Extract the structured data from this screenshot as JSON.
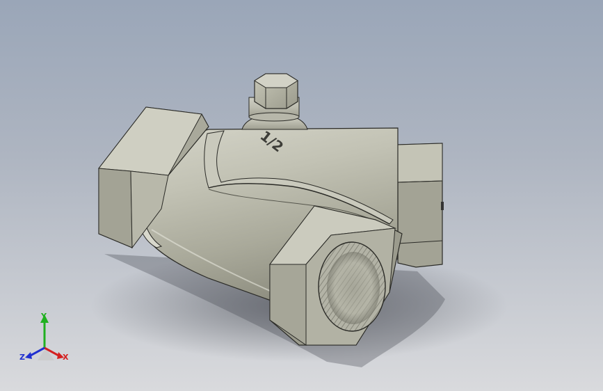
{
  "viewport": {
    "background_top": "#9aa6b8",
    "background_bottom": "#d9dadd"
  },
  "model": {
    "name": "y-strainer-valve",
    "body_color": "#b8b8a8",
    "engraving": "1/2"
  },
  "triad": {
    "x_label": "X",
    "y_label": "Y",
    "z_label": "Z",
    "x_color": "#d42020",
    "y_color": "#20b020",
    "z_color": "#2030d0"
  }
}
